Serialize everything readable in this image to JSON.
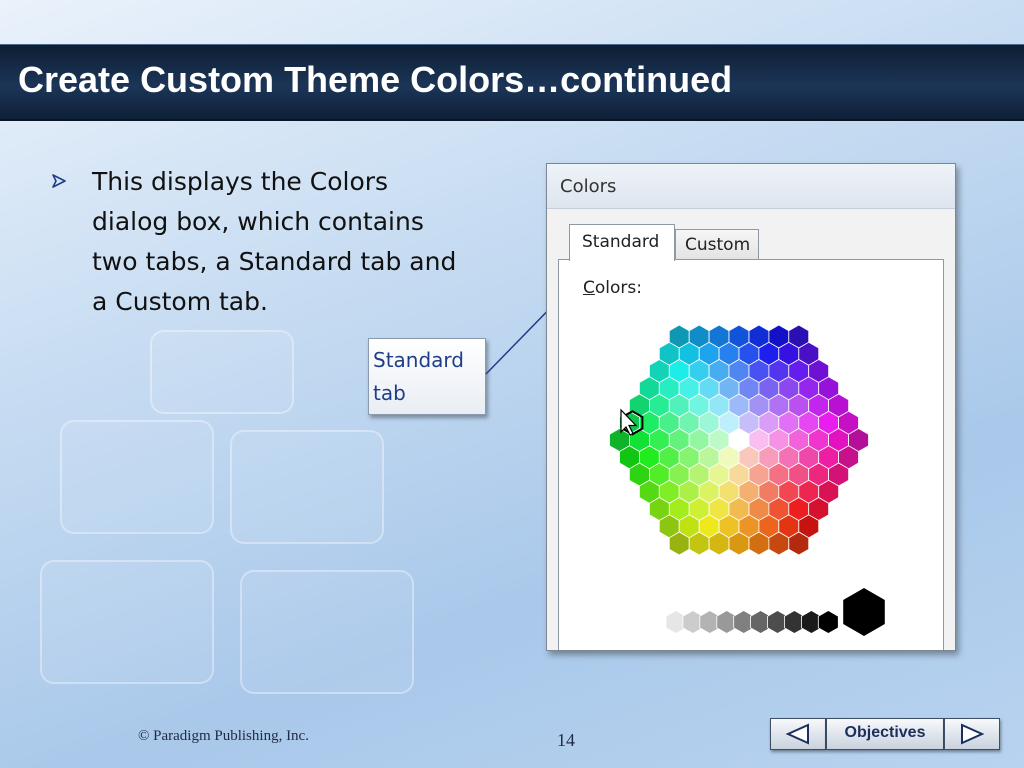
{
  "slide": {
    "title": "Create Custom Theme Colors…continued",
    "bullet_text": "This displays the Colors dialog box, which contains two tabs, a Standard tab and a Custom tab.",
    "callout_line1": "Standard",
    "callout_line2": "tab",
    "footer_copyright": "© Paradigm Publishing, Inc.",
    "page_number": "14"
  },
  "dialog": {
    "title": "Colors",
    "tabs": [
      {
        "label": "Standard",
        "selected": true
      },
      {
        "label": "Custom",
        "selected": false
      }
    ],
    "colors_label_first": "C",
    "colors_label_rest": "olors:"
  },
  "navigation": {
    "prev_icon": "triangle-left-icon",
    "objectives_label": "Objectives",
    "next_icon": "triangle-right-icon"
  },
  "colors": {
    "title_bar": "#16304f",
    "callout_text": "#1f3d8a",
    "bullet_arrow": "#1f3d8a",
    "nav_text": "#1a2f5e"
  },
  "icons": {
    "bullet": "arrowhead-bullet-icon",
    "cursor": "mouse-pointer-icon"
  }
}
